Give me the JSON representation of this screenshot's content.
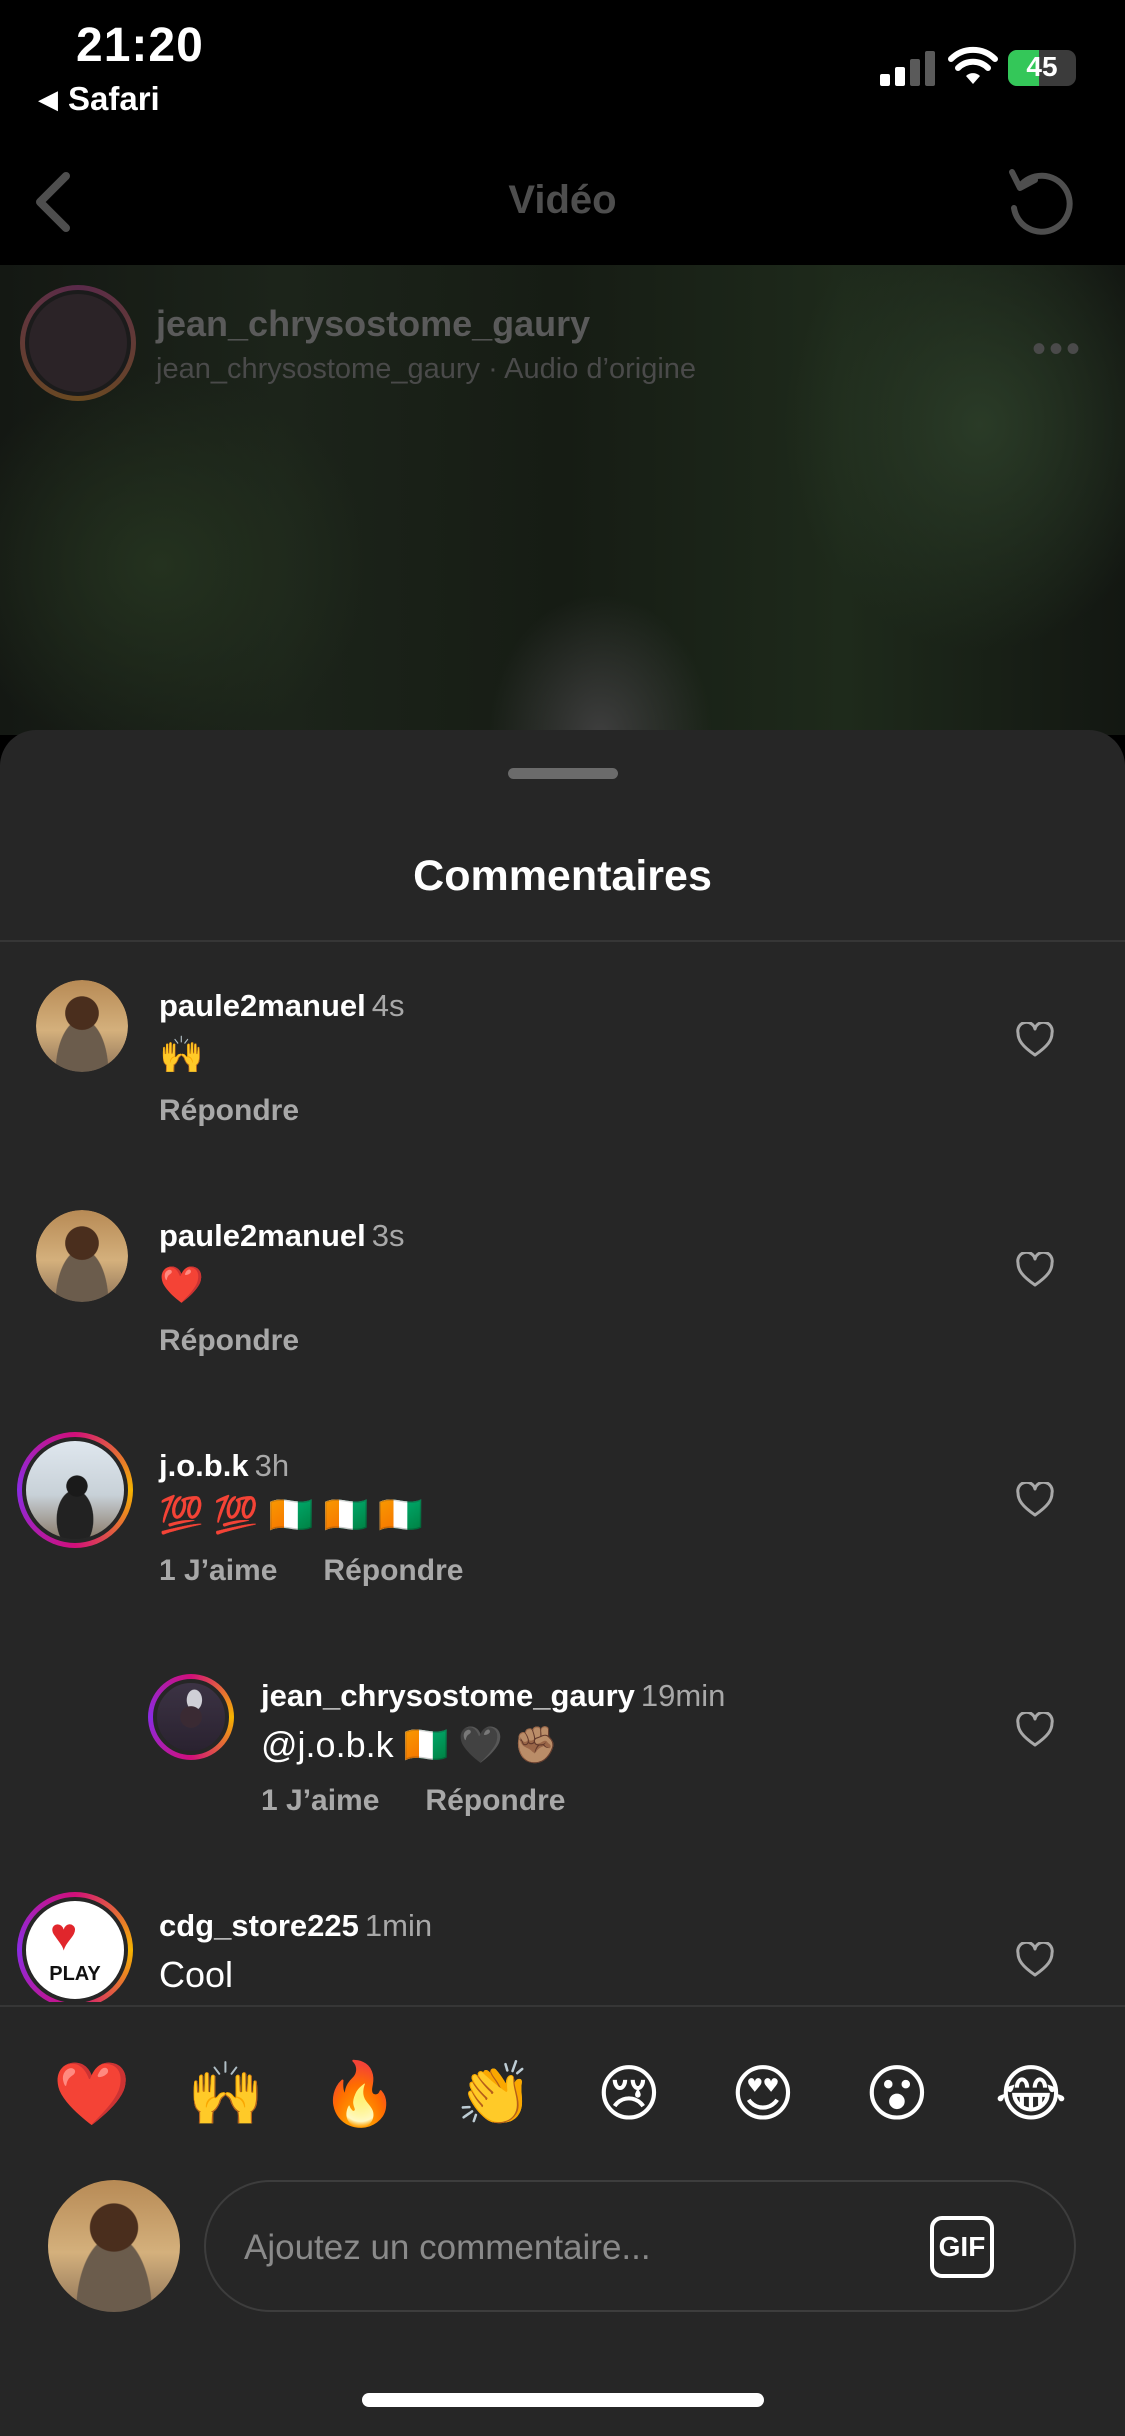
{
  "status_bar": {
    "time": "21:20",
    "back_app": "Safari",
    "battery_percent": 45,
    "battery_label": "45"
  },
  "nav": {
    "title": "Vidéo",
    "back_icon": "chevron-left-icon",
    "refresh_icon": "refresh-icon"
  },
  "video": {
    "username": "jean_chrysostome_gaury",
    "subtitle": "jean_chrysostome_gaury · Audio d’origine",
    "more": "•••"
  },
  "sheet": {
    "title": "Commentaires"
  },
  "comments": [
    {
      "username": "paule2manuel",
      "time": "4s",
      "text": "🙌",
      "likes": "",
      "reply": "Répondre"
    },
    {
      "username": "paule2manuel",
      "time": "3s",
      "text": "❤️",
      "likes": "",
      "reply": "Répondre"
    },
    {
      "username": "j.o.b.k",
      "time": "3h",
      "text": "💯 💯 🇨🇮 🇨🇮 🇨🇮",
      "likes": "1 J’aime",
      "reply": "Répondre"
    },
    {
      "username": "jean_chrysostome_gaury",
      "time": "19min",
      "text": "@j.o.b.k 🇨🇮 🖤 ✊🏽",
      "likes": "1 J’aime",
      "reply": "Répondre"
    },
    {
      "username": "cdg_store225",
      "time": "1min",
      "text": "Cool",
      "likes": "",
      "reply": ""
    }
  ],
  "cdg_avatar_text": "PLAY",
  "emoji_bar": [
    "❤️",
    "🙌",
    "🔥",
    "👏",
    "😢",
    "😍",
    "😮",
    "😂"
  ],
  "composer": {
    "placeholder": "Ajoutez un commentaire...",
    "gif_label": "GIF"
  },
  "colors": {
    "sheet_bg": "#262626",
    "muted_text": "#a8a8a8",
    "battery_green": "#34c759"
  }
}
